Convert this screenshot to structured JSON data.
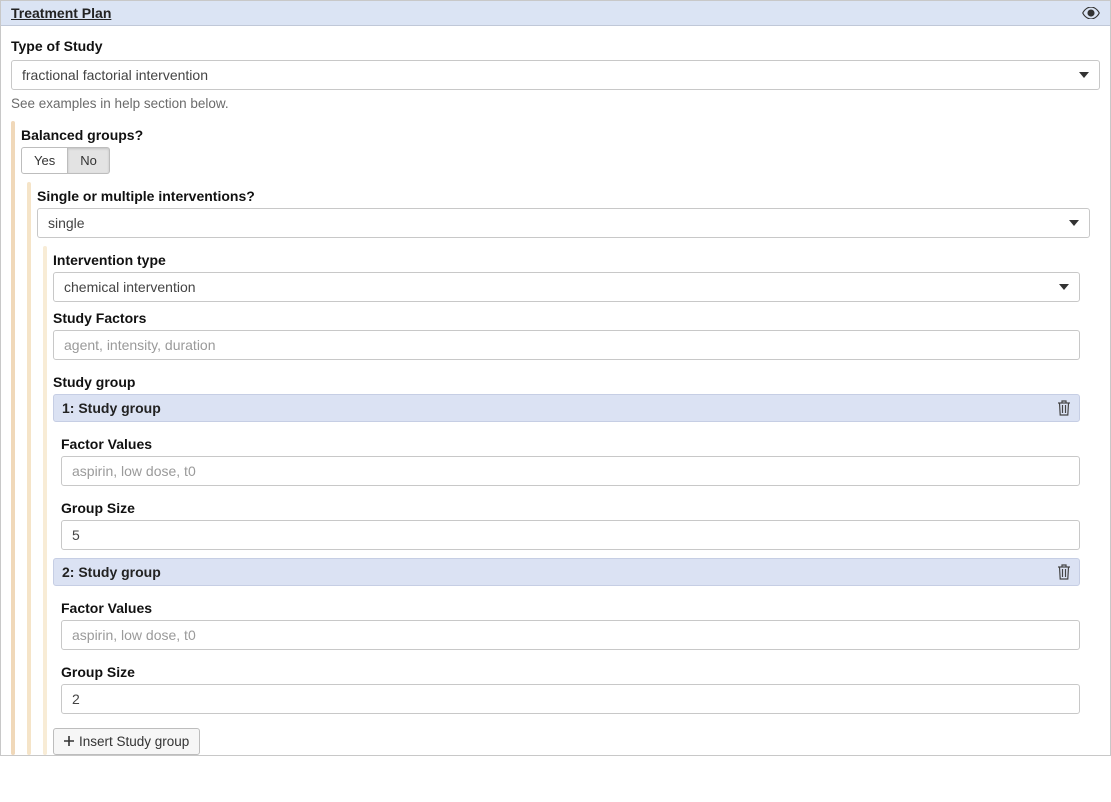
{
  "header": {
    "title": "Treatment Plan"
  },
  "type_of_study": {
    "label": "Type of Study",
    "value": "fractional factorial intervention",
    "helper": "See examples in help section below."
  },
  "balanced_groups": {
    "label": "Balanced groups?",
    "yes": "Yes",
    "no": "No",
    "selected": "No"
  },
  "interventions_mode": {
    "label": "Single or multiple interventions?",
    "value": "single"
  },
  "intervention_type": {
    "label": "Intervention type",
    "value": "chemical intervention"
  },
  "study_factors": {
    "label": "Study Factors",
    "placeholder": "agent, intensity, duration",
    "value": ""
  },
  "study_group": {
    "label": "Study group",
    "insert_label": "Insert Study group",
    "groups": [
      {
        "header": "1: Study group",
        "factor_values_label": "Factor Values",
        "factor_values_placeholder": "aspirin, low dose, t0",
        "factor_values_value": "",
        "group_size_label": "Group Size",
        "group_size_value": "5"
      },
      {
        "header": "2: Study group",
        "factor_values_label": "Factor Values",
        "factor_values_placeholder": "aspirin, low dose, t0",
        "factor_values_value": "",
        "group_size_label": "Group Size",
        "group_size_value": "2"
      }
    ]
  }
}
